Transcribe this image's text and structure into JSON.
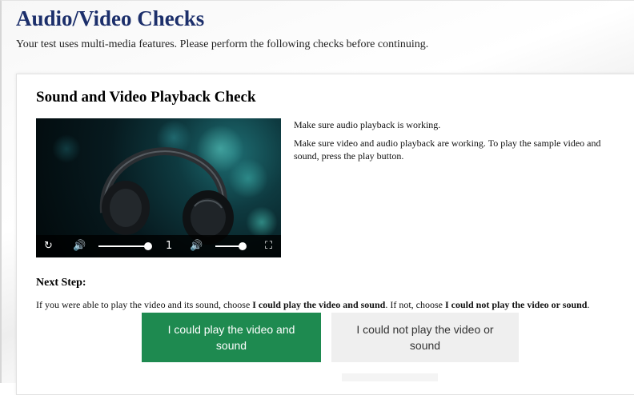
{
  "page": {
    "title": "Audio/Video Checks",
    "intro": "Your test uses multi-media features. Please perform the following checks before continuing."
  },
  "check": {
    "section_title": "Sound and Video Playback Check",
    "audio_note": "Make sure audio playback is working.",
    "video_note": "Make sure video and audio playback are working. To play the sample video and sound, press the play button."
  },
  "player": {
    "replay_icon": "replay-icon",
    "volume_icon": "volume-icon",
    "volume_level": 1.0,
    "speed_value": "1",
    "second_volume_icon": "volume-icon",
    "second_volume_level": 0.85,
    "fullscreen_icon": "fullscreen-icon"
  },
  "next": {
    "heading": "Next Step:",
    "text_before": "If you were able to play the video and its sound, choose ",
    "yes_bold": "I could play the video and sound",
    "text_middle": ". If not, choose ",
    "no_bold": "I could not play the video or sound",
    "text_end": ".",
    "yes_button": "I could play the video and sound",
    "no_button": "I could not play the video or sound"
  },
  "colors": {
    "title": "#1c2f6b",
    "yes_button_bg": "#1e8a50",
    "no_button_bg": "#efefef"
  }
}
